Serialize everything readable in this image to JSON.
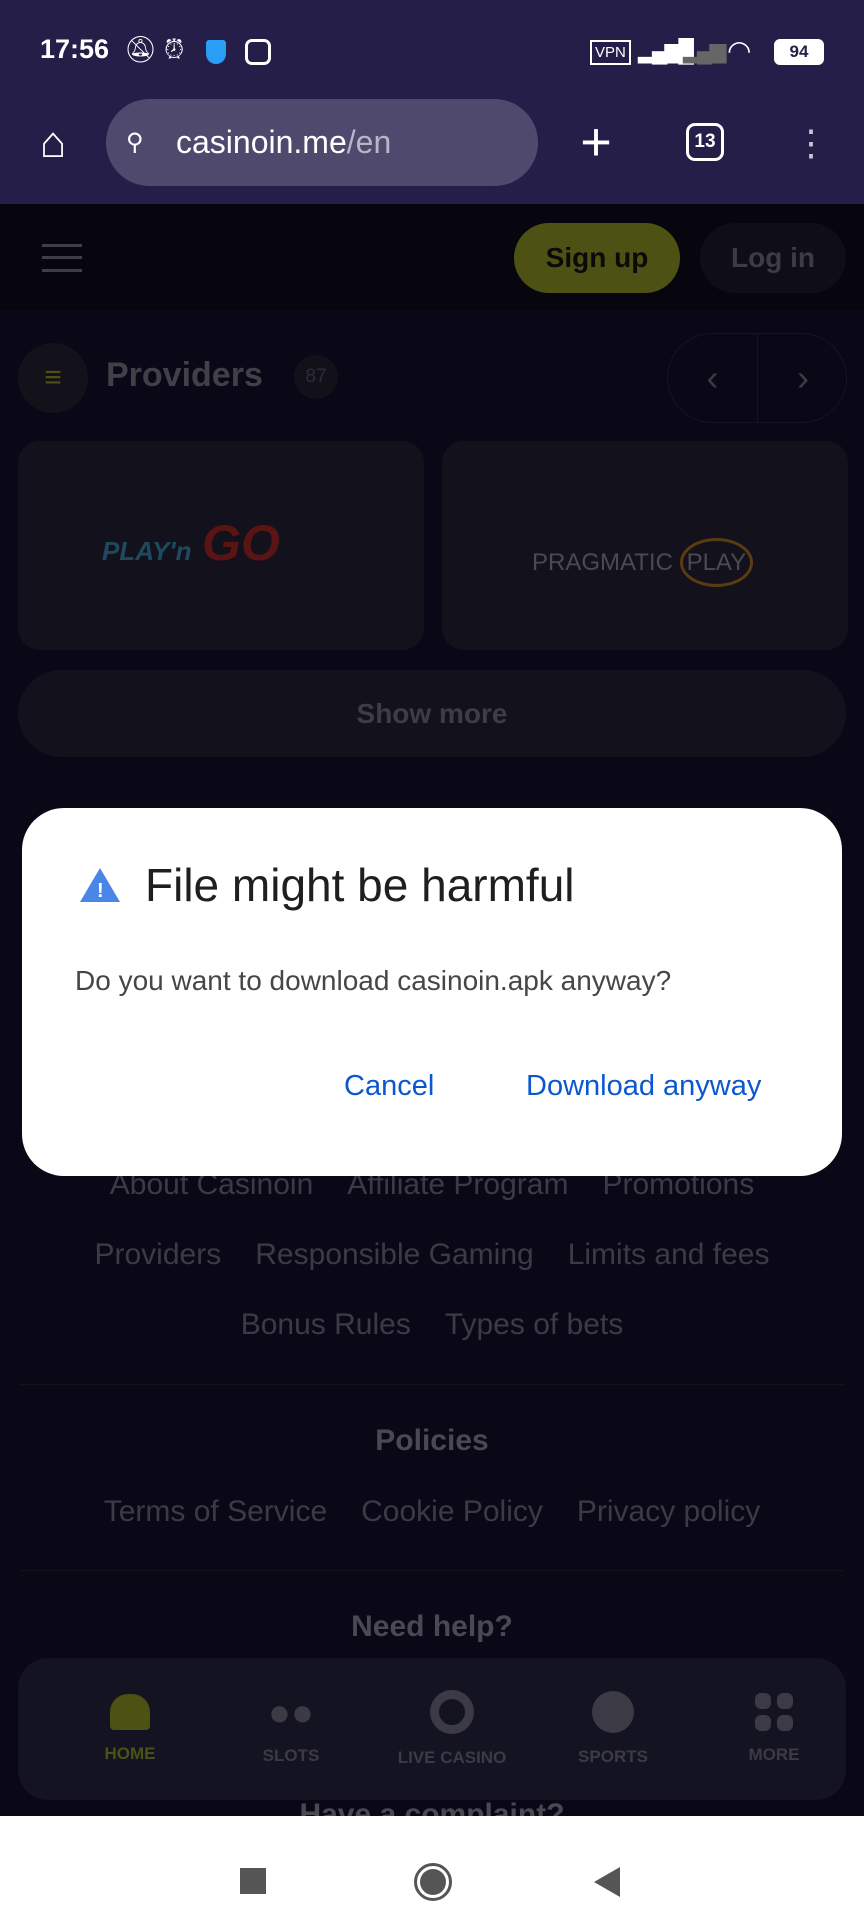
{
  "status_bar": {
    "time": "17:56",
    "battery": "94",
    "vpn": "VPN",
    "icons": [
      "mute-icon",
      "alarm-icon",
      "shield-icon",
      "instagram-icon",
      "signal-icon",
      "signal-off-icon",
      "wifi-icon",
      "battery-icon"
    ]
  },
  "browser": {
    "url_host": "casinoin.me",
    "url_path": "/en",
    "tab_count": "13"
  },
  "header": {
    "signup": "Sign up",
    "login": "Log in",
    "accent": "#4d5214"
  },
  "providers": {
    "title": "Providers",
    "count": "87",
    "cards": [
      "PLAY'n GO",
      "PRAGMATIC PLAY"
    ],
    "show_more": "Show more"
  },
  "dialog": {
    "title": "File might be harmful",
    "message": "Do you want to download casinoin.apk anyway?",
    "cancel": "Cancel",
    "confirm": "Download anyway",
    "accent": "#0b57d0"
  },
  "footer": {
    "links_rows": [
      [
        "About Casinoin",
        "Affiliate Program",
        "Promotions"
      ],
      [
        "Providers",
        "Responsible Gaming",
        "Limits and fees"
      ],
      [
        "Bonus Rules",
        "Types of bets"
      ]
    ],
    "policies_title": "Policies",
    "policies": [
      "Terms of Service",
      "Cookie Policy",
      "Privacy policy"
    ],
    "help_title": "Need help?",
    "complaint_title": "Have a complaint?"
  },
  "bottom_nav": [
    {
      "label": "HOME",
      "icon": "home-icon",
      "active": true
    },
    {
      "label": "SLOTS",
      "icon": "cherry-icon"
    },
    {
      "label": "LIVE CASINO",
      "icon": "chip-icon"
    },
    {
      "label": "SPORTS",
      "icon": "ball-icon"
    },
    {
      "label": "MORE",
      "icon": "grid-icon"
    }
  ]
}
